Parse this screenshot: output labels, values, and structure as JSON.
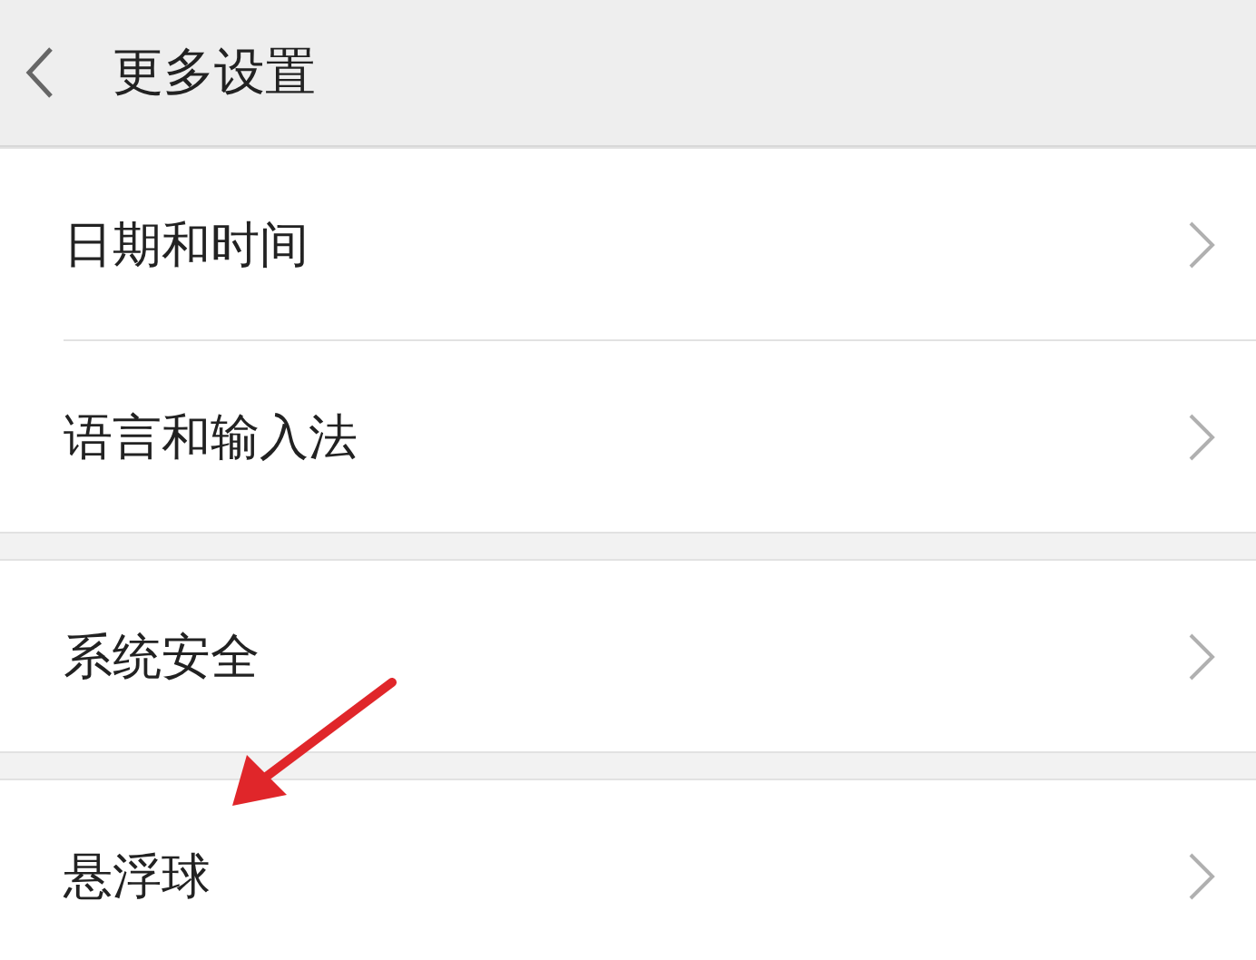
{
  "header": {
    "title": "更多设置"
  },
  "sections": [
    {
      "items": [
        {
          "label": "日期和时间"
        },
        {
          "label": "语言和输入法"
        }
      ]
    },
    {
      "items": [
        {
          "label": "系统安全"
        }
      ]
    },
    {
      "items": [
        {
          "label": "悬浮球"
        }
      ]
    }
  ]
}
